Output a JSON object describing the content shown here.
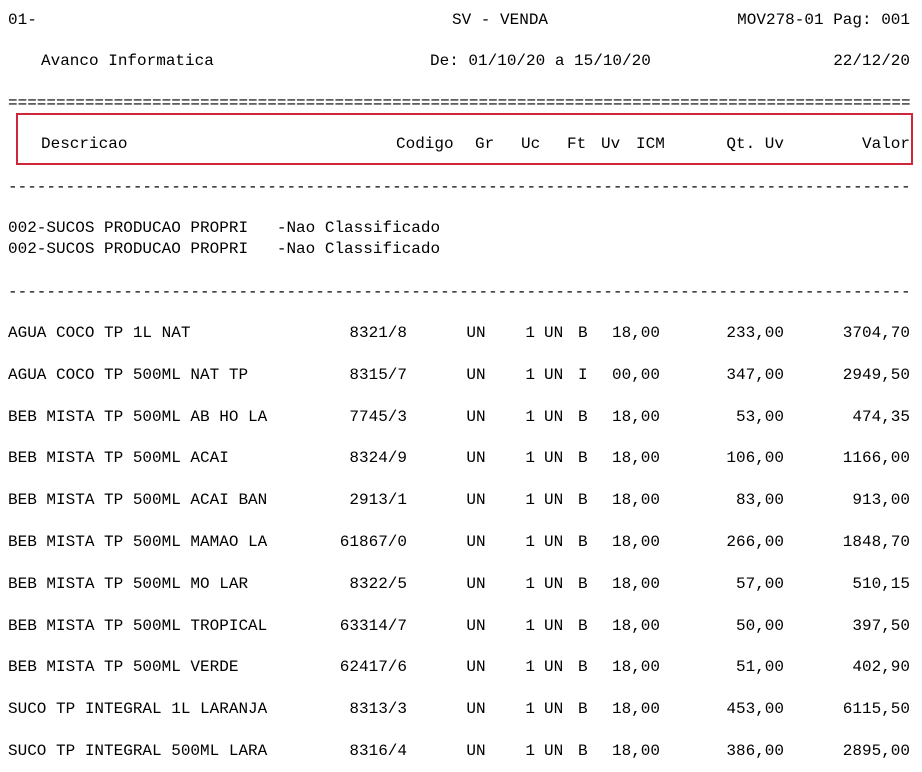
{
  "header": {
    "page_code": "01-",
    "title": "SV - VENDA",
    "report_id": "MOV278-01 Pag: 001",
    "company": "Avanco Informatica",
    "period": "De: 01/10/20 a 15/10/20",
    "print_date": "22/12/20",
    "double_rule": "===============================================================================================================",
    "single_rule": "---------------------------------------------------------------------------------------------------------------"
  },
  "columns": {
    "descricao": "Descricao",
    "codigo": "Codigo",
    "gr": "Gr",
    "uc": "Uc",
    "ft": "Ft",
    "uv": "Uv",
    "icm": "ICM",
    "qt_uv": "Qt. Uv",
    "valor": "Valor"
  },
  "group": {
    "line1": "002-SUCOS PRODUCAO PROPRI   -Nao Classificado",
    "line2": "002-SUCOS PRODUCAO PROPRI   -Nao Classificado"
  },
  "rows": [
    {
      "desc": "AGUA COCO TP 1L NAT",
      "codigo": "8321/8",
      "gr": "UN",
      "uc": "1",
      "ft": "UN",
      "uv": "B",
      "icm": "18,00",
      "qt": "233,00",
      "valor": "3704,70"
    },
    {
      "desc": "AGUA COCO TP 500ML NAT TP",
      "codigo": "8315/7",
      "gr": "UN",
      "uc": "1",
      "ft": "UN",
      "uv": "I",
      "icm": "00,00",
      "qt": "347,00",
      "valor": "2949,50"
    },
    {
      "desc": "BEB MISTA TP 500ML AB HO LA",
      "codigo": "7745/3",
      "gr": "UN",
      "uc": "1",
      "ft": "UN",
      "uv": "B",
      "icm": "18,00",
      "qt": "53,00",
      "valor": "474,35"
    },
    {
      "desc": "BEB MISTA TP 500ML ACAI",
      "codigo": "8324/9",
      "gr": "UN",
      "uc": "1",
      "ft": "UN",
      "uv": "B",
      "icm": "18,00",
      "qt": "106,00",
      "valor": "1166,00"
    },
    {
      "desc": "BEB MISTA TP 500ML ACAI BAN",
      "codigo": "2913/1",
      "gr": "UN",
      "uc": "1",
      "ft": "UN",
      "uv": "B",
      "icm": "18,00",
      "qt": "83,00",
      "valor": "913,00"
    },
    {
      "desc": "BEB MISTA TP 500ML MAMAO LA",
      "codigo": "61867/0",
      "gr": "UN",
      "uc": "1",
      "ft": "UN",
      "uv": "B",
      "icm": "18,00",
      "qt": "266,00",
      "valor": "1848,70"
    },
    {
      "desc": "BEB MISTA TP 500ML MO LAR",
      "codigo": "8322/5",
      "gr": "UN",
      "uc": "1",
      "ft": "UN",
      "uv": "B",
      "icm": "18,00",
      "qt": "57,00",
      "valor": "510,15"
    },
    {
      "desc": "BEB MISTA TP 500ML TROPICAL",
      "codigo": "63314/7",
      "gr": "UN",
      "uc": "1",
      "ft": "UN",
      "uv": "B",
      "icm": "18,00",
      "qt": "50,00",
      "valor": "397,50"
    },
    {
      "desc": "BEB MISTA TP 500ML VERDE",
      "codigo": "62417/6",
      "gr": "UN",
      "uc": "1",
      "ft": "UN",
      "uv": "B",
      "icm": "18,00",
      "qt": "51,00",
      "valor": "402,90"
    },
    {
      "desc": "SUCO TP INTEGRAL 1L LARANJA",
      "codigo": "8313/3",
      "gr": "UN",
      "uc": "1",
      "ft": "UN",
      "uv": "B",
      "icm": "18,00",
      "qt": "453,00",
      "valor": "6115,50"
    },
    {
      "desc": "SUCO TP INTEGRAL 500ML LARA",
      "codigo": "8316/4",
      "gr": "UN",
      "uc": "1",
      "ft": "UN",
      "uv": "B",
      "icm": "18,00",
      "qt": "386,00",
      "valor": "2895,00"
    }
  ],
  "colors": {
    "highlight": "#d0263a"
  }
}
